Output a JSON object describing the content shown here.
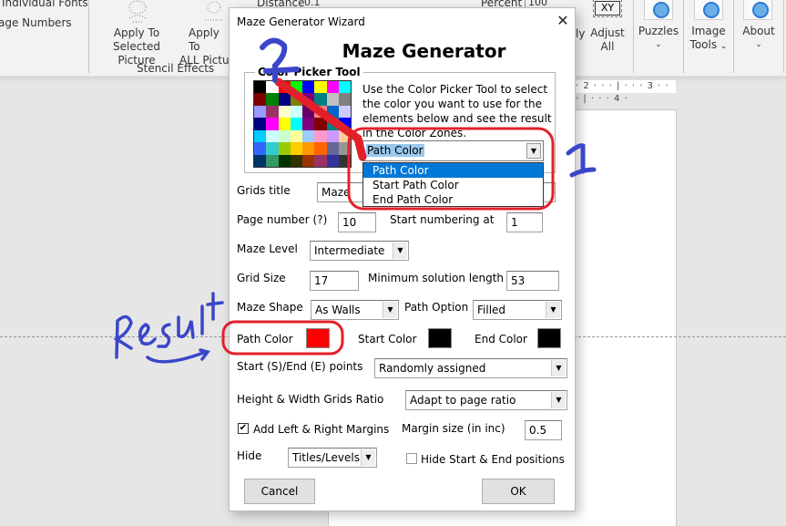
{
  "ribbon": {
    "left_items": [
      "Individual Fonts",
      "age Numbers"
    ],
    "stencil_buttons": [
      "Apply To Selected Picture",
      "Apply To ALL Pictures"
    ],
    "stencil_buttons_lines": [
      [
        "Apply To",
        "Selected Picture"
      ],
      [
        "Apply To",
        "ALL Pictur"
      ]
    ],
    "stencil_group_label": "Stencil Effects",
    "distance_label": "Distance",
    "distance_value": "0.1",
    "percent_label": "Percent",
    "percent_value": "100",
    "apply_partial": "ly",
    "adjust_all": [
      "Adjust",
      "All"
    ],
    "xy_label": "XY",
    "puzzles": "Puzzles",
    "image_tools": [
      "Image",
      "Tools"
    ],
    "about": "About",
    "ruler": "· 2 · · · | · · · 3 · · · | · · · 4 ·"
  },
  "dialog": {
    "window_title": "Maze Generator Wizard",
    "close_glyph": "✕",
    "heading": "Maze Generator",
    "color_picker": {
      "legend": "Color Picker Tool",
      "instructions": "Use the Color Picker Tool to select the color you want to use for the elements below and see the result in the Color Zones.",
      "palette": [
        "#000000",
        "#ffffff",
        "#ff0000",
        "#00ff00",
        "#0000ff",
        "#ffff00",
        "#ff00ff",
        "#00ffff",
        "#800000",
        "#008000",
        "#000080",
        "#808000",
        "#800080",
        "#008080",
        "#c0c0c0",
        "#808080",
        "#9999ff",
        "#993366",
        "#ffffcc",
        "#ccffff",
        "#660066",
        "#ff8080",
        "#0066cc",
        "#ccccff",
        "#000080",
        "#ff00ff",
        "#ffff00",
        "#00ffff",
        "#800080",
        "#800000",
        "#008080",
        "#0000ff",
        "#00ccff",
        "#ccffff",
        "#ccffcc",
        "#ffff99",
        "#99ccff",
        "#ff99cc",
        "#cc99ff",
        "#ffcc99",
        "#3366ff",
        "#33cccc",
        "#99cc00",
        "#ffcc00",
        "#ff9900",
        "#ff6600",
        "#666699",
        "#969696",
        "#003366",
        "#339966",
        "#003300",
        "#333300",
        "#993300",
        "#993366",
        "#333399",
        "#333333"
      ],
      "target_select": {
        "value": "Path Color",
        "options": [
          "Path Color",
          "Start Path Color",
          "End Path Color"
        ],
        "active_index": 0
      }
    },
    "fields": {
      "grids_title": {
        "label": "Grids title",
        "value": "Maze"
      },
      "page_number": {
        "label": "Page number (?)",
        "value": "10"
      },
      "start_numbering": {
        "label": "Start numbering at",
        "value": "1"
      },
      "maze_level": {
        "label": "Maze Level",
        "value": "Intermediate"
      },
      "grid_size": {
        "label": "Grid Size",
        "value": "17"
      },
      "min_solution": {
        "label": "Minimum solution length",
        "value": "53"
      },
      "maze_shape": {
        "label": "Maze Shape",
        "value": "As Walls"
      },
      "path_option": {
        "label": "Path Option",
        "value": "Filled"
      },
      "path_color": {
        "label": "Path Color",
        "color": "#ff0000"
      },
      "start_color": {
        "label": "Start Color",
        "color": "#000000"
      },
      "end_color": {
        "label": "End Color",
        "color": "#000000"
      },
      "start_end_points": {
        "label": "Start (S)/End (E) points",
        "value": "Randomly assigned"
      },
      "ratio": {
        "label": "Height & Width Grids Ratio",
        "value": "Adapt to page ratio"
      },
      "add_margins": {
        "label": "Add Left & Right Margins",
        "checked": true
      },
      "margin_size": {
        "label": "Margin size (in inc)",
        "value": "0.5"
      },
      "hide": {
        "label": "Hide",
        "value": "Titles/Levels"
      },
      "hide_start_end": {
        "label": "Hide Start & End positions",
        "checked": false
      }
    },
    "buttons": {
      "cancel": "Cancel",
      "ok": "OK"
    },
    "dropdown_arrow": "▼",
    "check_glyph": "✔"
  },
  "annotations": {
    "number_1": "1",
    "number_2": "2",
    "result_text": "Result",
    "highlight_color": "#e3202a",
    "ink_color": "#3a46c9"
  }
}
